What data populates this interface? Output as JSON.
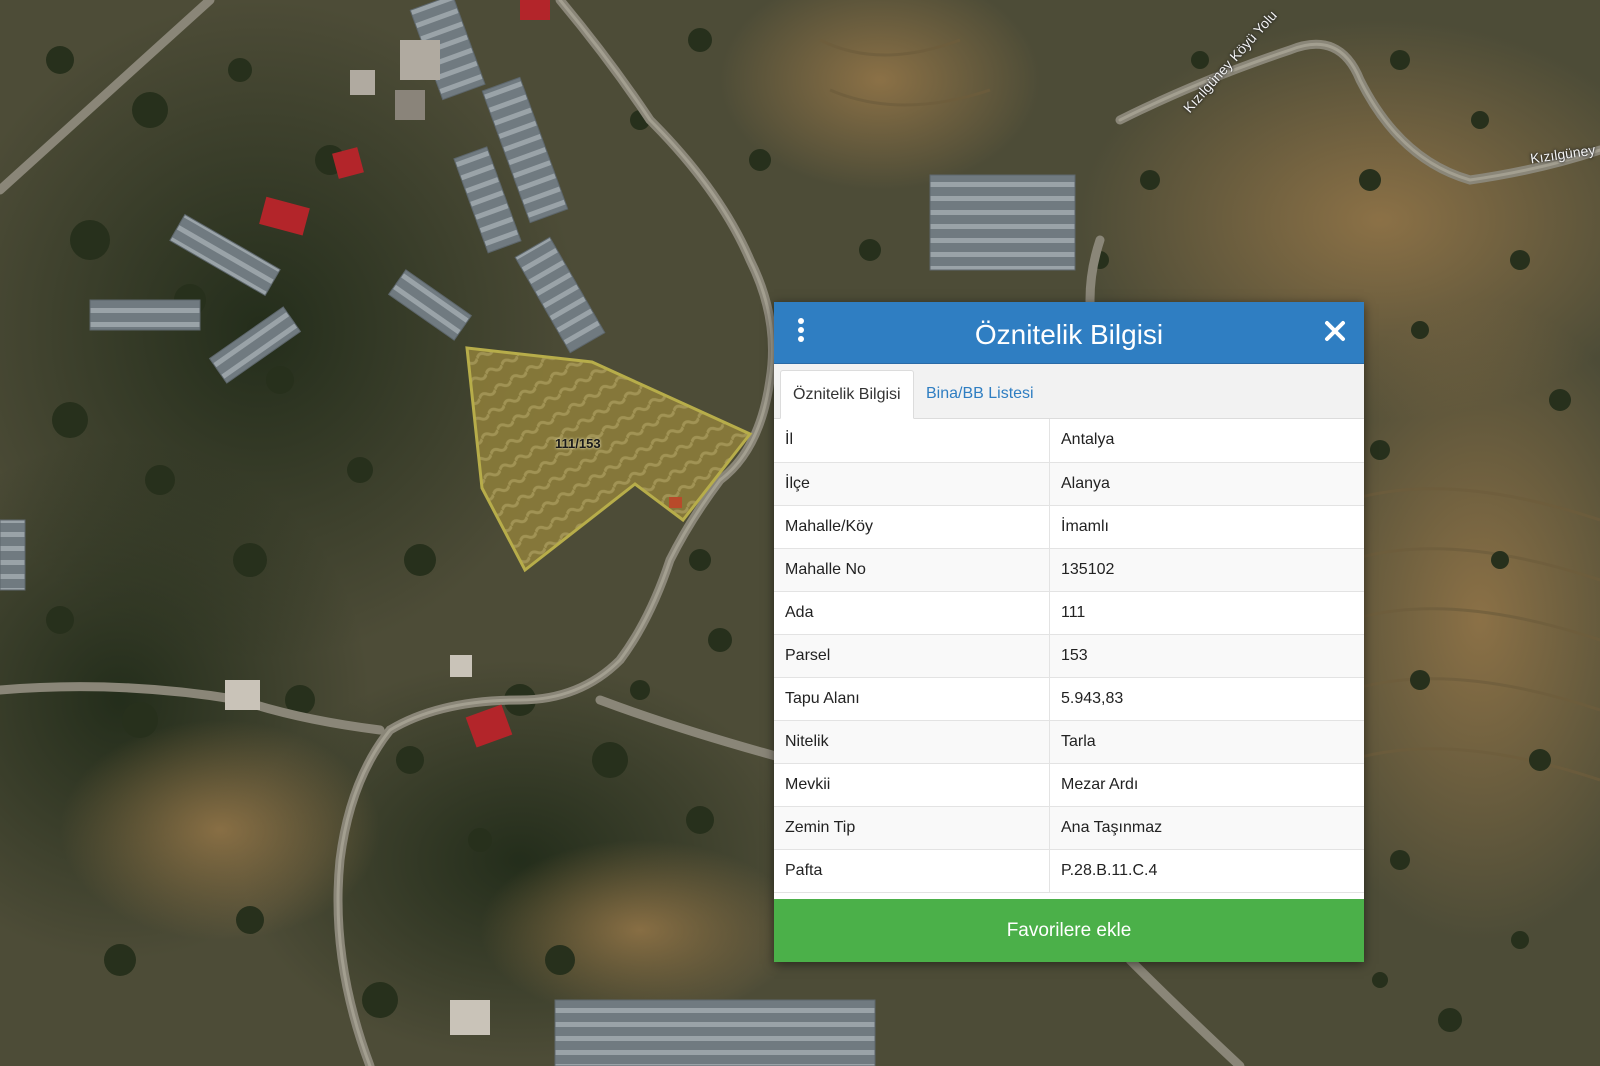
{
  "map": {
    "road_labels": [
      "Kızılgüney Köyü Yolu",
      "Kızılgüney"
    ],
    "parcel_label": "111/153",
    "colors": {
      "parcel_outline": "#b7ad4a",
      "parcel_fill": "#9a8a3c"
    }
  },
  "panel": {
    "title": "Öznitelik Bilgisi",
    "icons": {
      "menu": "vertical-dots-icon",
      "close": "close-icon"
    },
    "tabs": [
      {
        "label": "Öznitelik Bilgisi",
        "active": true
      },
      {
        "label": "Bina/BB Listesi",
        "active": false
      }
    ],
    "rows": [
      {
        "key": "İl",
        "value": "Antalya"
      },
      {
        "key": "İlçe",
        "value": "Alanya"
      },
      {
        "key": "Mahalle/Köy",
        "value": "İmamlı"
      },
      {
        "key": "Mahalle No",
        "value": "135102"
      },
      {
        "key": "Ada",
        "value": "111"
      },
      {
        "key": "Parsel",
        "value": "153"
      },
      {
        "key": "Tapu Alanı",
        "value": "5.943,83"
      },
      {
        "key": "Nitelik",
        "value": "Tarla"
      },
      {
        "key": "Mevkii",
        "value": "Mezar Ardı"
      },
      {
        "key": "Zemin Tip",
        "value": "Ana Taşınmaz"
      },
      {
        "key": "Pafta",
        "value": "P.28.B.11.C.4"
      }
    ],
    "favorite_button": "Favorilere ekle",
    "colors": {
      "header": "#2f7ec2",
      "button": "#4bb049",
      "tab_link": "#2f7ec2"
    }
  }
}
